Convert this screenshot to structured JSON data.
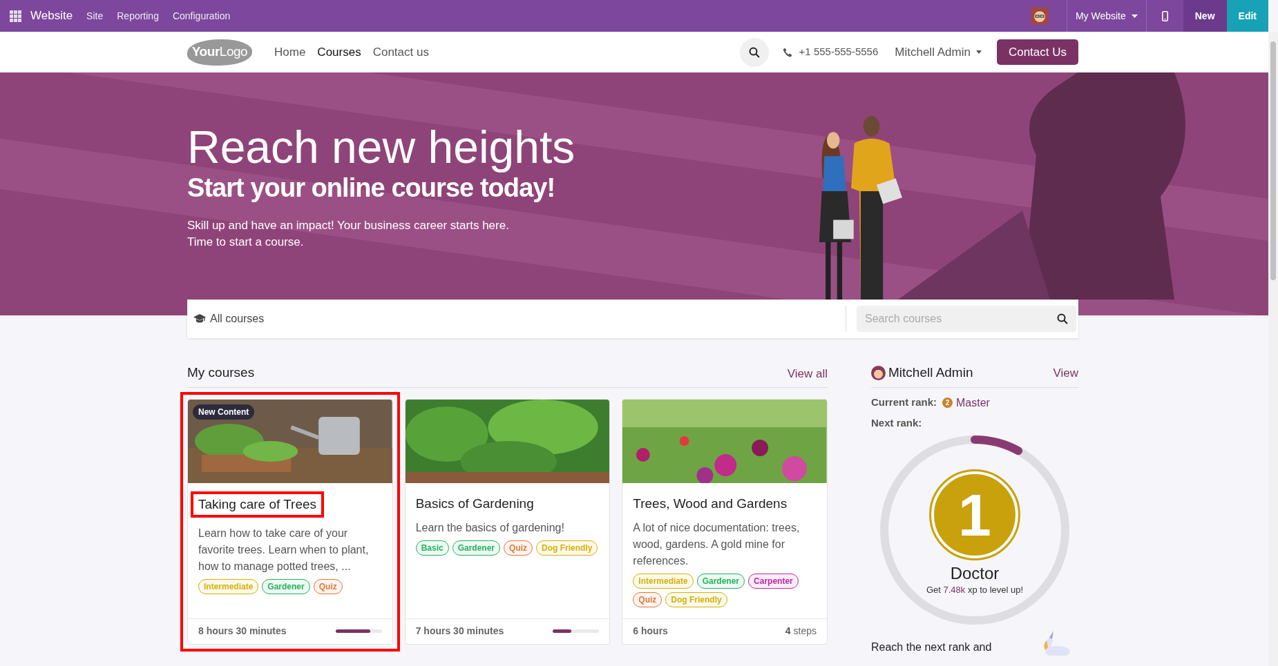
{
  "top_bar": {
    "app_name": "Website",
    "menu": [
      "Site",
      "Reporting",
      "Configuration"
    ],
    "website_switcher": "My Website",
    "buttons": [
      {
        "label": "New",
        "kind": "new"
      },
      {
        "label": "Edit",
        "kind": "edit"
      }
    ]
  },
  "header": {
    "logo": {
      "part_1": "Your",
      "part_2": "Logo"
    },
    "nav": [
      {
        "label": "Home",
        "selected": false
      },
      {
        "label": "Courses",
        "selected": true
      },
      {
        "label": "Contact us",
        "selected": false
      }
    ],
    "phone": "+1 555-555-5556",
    "user": "Mitchell Admin",
    "cta": "Contact Us"
  },
  "hero": {
    "title": "Reach new heights",
    "subtitle": "Start your online course today!",
    "text": [
      "Skill up and have an impact! Your business career starts here.",
      "Time to start a course."
    ]
  },
  "filter_bar": {
    "label": "All courses",
    "search": {
      "placeholder": "Search courses"
    }
  },
  "my_courses": {
    "title": "My courses",
    "view_all": "View all",
    "courses": [
      {
        "title": "Taking care of Trees",
        "highlighted": true,
        "badge": "New Content",
        "description": "Learn how to take care of your favorite trees. Learn when to plant, how to manage potted trees, ...",
        "tags": [
          {
            "label": "Intermediate",
            "color": "#d4b106"
          },
          {
            "label": "Gardener",
            "color": "#22b35e"
          },
          {
            "label": "Quiz",
            "color": "#e0783a"
          }
        ],
        "duration": "8 hours 30 minutes",
        "footer": {
          "kind": "progress",
          "level": 0.75
        }
      },
      {
        "title": "Basics of Gardening",
        "highlighted": false,
        "description": "Learn the basics of gardening!",
        "tags": [
          {
            "label": "Basic",
            "color": "#22b35e"
          },
          {
            "label": "Gardener",
            "color": "#22b35e"
          },
          {
            "label": "Quiz",
            "color": "#e0783a"
          },
          {
            "label": "Dog Friendly",
            "color": "#d4b106"
          }
        ],
        "duration": "7 hours 30 minutes",
        "footer": {
          "kind": "progress",
          "level": 0.4
        }
      },
      {
        "title": "Trees, Wood and Gardens",
        "highlighted": false,
        "description": "A lot of nice documentation: trees, wood, gardens. A gold mine for references.",
        "tags": [
          {
            "label": "Intermediate",
            "color": "#d4b106"
          },
          {
            "label": "Gardener",
            "color": "#22b35e"
          },
          {
            "label": "Carpenter",
            "color": "#c026a8"
          },
          {
            "label": "Quiz",
            "color": "#e0783a"
          },
          {
            "label": "Dog Friendly",
            "color": "#d4b106"
          }
        ],
        "duration": "6 hours",
        "footer": {
          "kind": "steps",
          "text": "**4** steps"
        }
      }
    ]
  },
  "profile": {
    "name": "Mitchell Admin",
    "view": "View",
    "current_rank_label": "Current rank:",
    "current_rank_number": "2",
    "current_rank": "Master",
    "next_rank_label": "Next rank:",
    "next_rank_number": "1",
    "next_rank": "Doctor",
    "xp_text": "Get **7.48k** xp to level up!",
    "level": 0.08,
    "reach_text": "Reach the next rank and"
  }
}
